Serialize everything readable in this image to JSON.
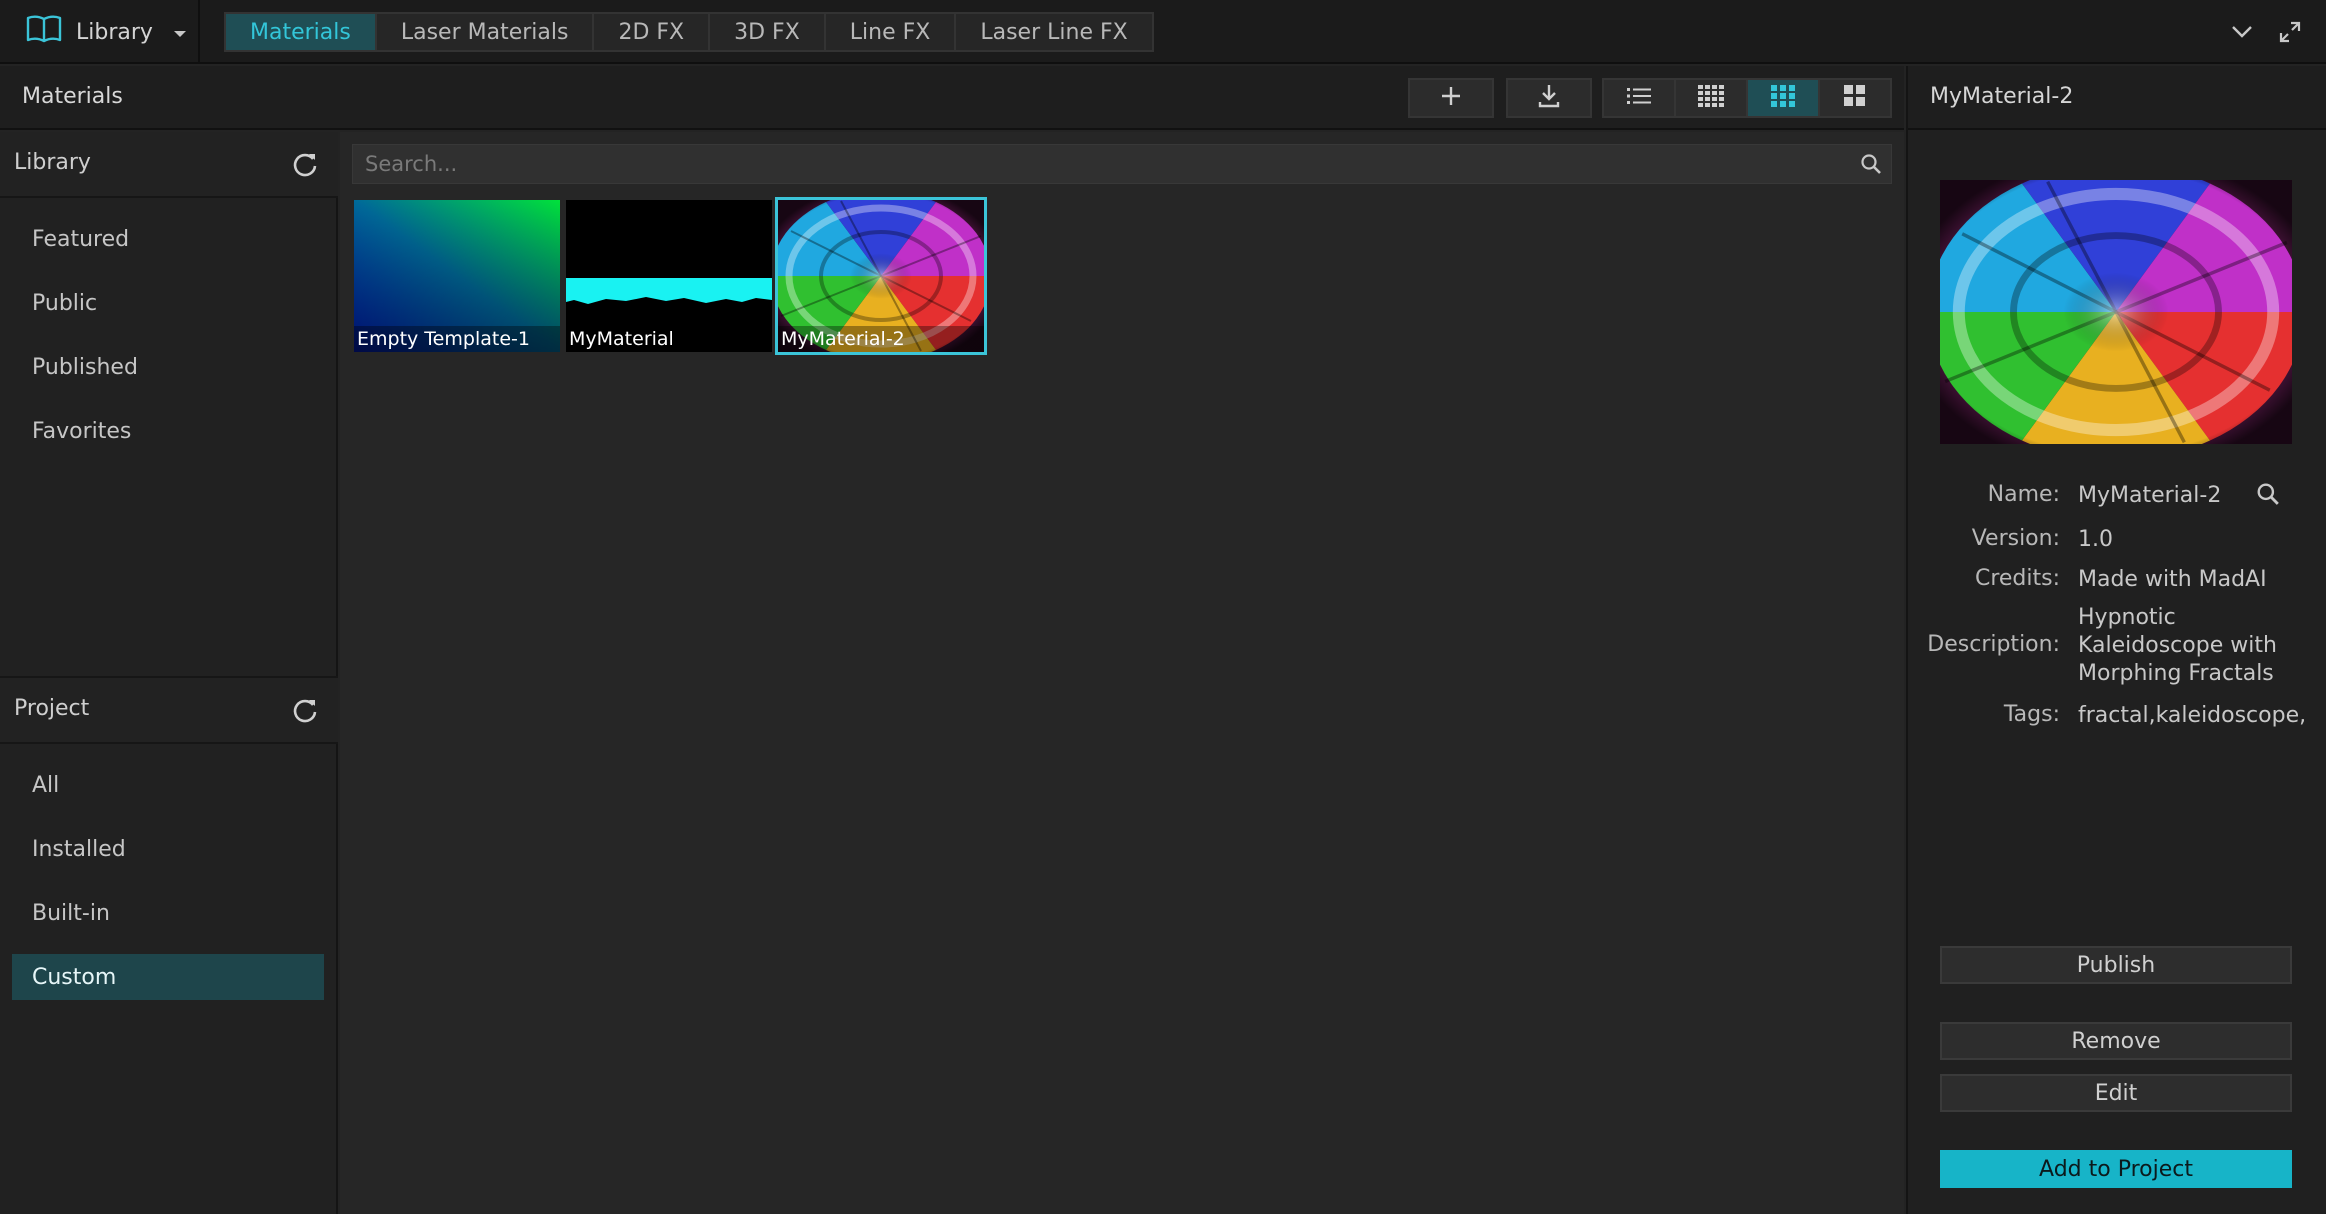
{
  "topbar": {
    "library_label": "Library",
    "tabs": [
      "Materials",
      "Laser Materials",
      "2D FX",
      "3D FX",
      "Line FX",
      "Laser Line FX"
    ],
    "active_tab": "Materials"
  },
  "header": {
    "title": "Materials"
  },
  "left": {
    "library_section": "Library",
    "library_items": [
      "Featured",
      "Public",
      "Published",
      "Favorites"
    ],
    "project_section": "Project",
    "project_items": [
      "All",
      "Installed",
      "Built-in",
      "Custom"
    ],
    "active_item": "Custom"
  },
  "search": {
    "placeholder": "Search..."
  },
  "materials": [
    {
      "name": "Empty Template-1"
    },
    {
      "name": "MyMaterial"
    },
    {
      "name": "MyMaterial-2",
      "selected": true
    }
  ],
  "details": {
    "title": "MyMaterial-2",
    "name_label": "Name:",
    "name": "MyMaterial-2",
    "version_label": "Version:",
    "version": "1.0",
    "credits_label": "Credits:",
    "credits": "Made with MadAI",
    "description_label": "Description:",
    "description": "Hypnotic Kaleidoscope with Morphing Fractals",
    "tags_label": "Tags:",
    "tags": "fractal,kaleidoscope,"
  },
  "actions": {
    "publish": "Publish",
    "remove": "Remove",
    "edit": "Edit",
    "add_to_project": "Add to Project"
  },
  "colors": {
    "accent": "#17b4c8",
    "active_tab_bg": "#1f4e55",
    "active_tab_text": "#33c6d9",
    "selected_nav_bg": "#1e454b"
  }
}
